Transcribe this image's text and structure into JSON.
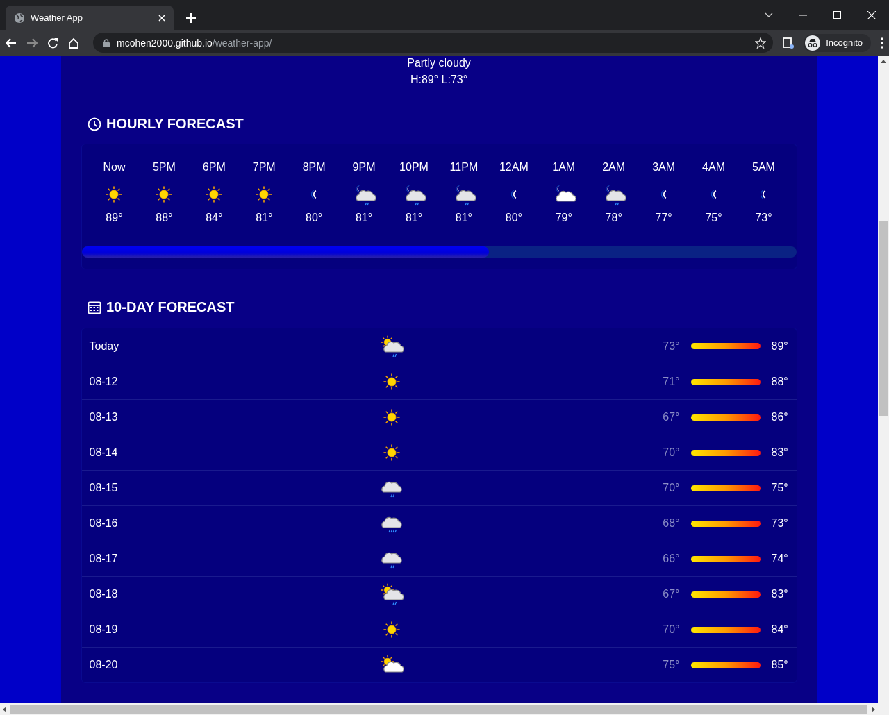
{
  "browser": {
    "tab_title": "Weather App",
    "url_host": "mcohen2000.github.io",
    "url_path": "/weather-app/",
    "profile": "Incognito"
  },
  "current": {
    "condition": "Partly cloudy",
    "high_low": "H:89° L:73°"
  },
  "hourly": {
    "title": "HOURLY FORECAST",
    "hours": [
      {
        "time": "Now",
        "kind": "sun",
        "temp": "89°"
      },
      {
        "time": "5PM",
        "kind": "sun",
        "temp": "88°"
      },
      {
        "time": "6PM",
        "kind": "sun",
        "temp": "84°"
      },
      {
        "time": "7PM",
        "kind": "sun",
        "temp": "81°"
      },
      {
        "time": "8PM",
        "kind": "moon",
        "temp": "80°"
      },
      {
        "time": "9PM",
        "kind": "moon-cloud-rain",
        "temp": "81°"
      },
      {
        "time": "10PM",
        "kind": "moon-cloud-rain",
        "temp": "81°"
      },
      {
        "time": "11PM",
        "kind": "moon-cloud-rain",
        "temp": "81°"
      },
      {
        "time": "12AM",
        "kind": "moon",
        "temp": "80°"
      },
      {
        "time": "1AM",
        "kind": "moon-cloud",
        "temp": "79°"
      },
      {
        "time": "2AM",
        "kind": "moon-cloud-rain",
        "temp": "78°"
      },
      {
        "time": "3AM",
        "kind": "moon",
        "temp": "77°"
      },
      {
        "time": "4AM",
        "kind": "moon",
        "temp": "75°"
      },
      {
        "time": "5AM",
        "kind": "moon",
        "temp": "73°"
      }
    ]
  },
  "daily": {
    "title": "10-DAY FORECAST",
    "days": [
      {
        "day": "Today",
        "kind": "sun-cloud-rain",
        "low": "73°",
        "high": "89°"
      },
      {
        "day": "08-12",
        "kind": "sun",
        "low": "71°",
        "high": "88°"
      },
      {
        "day": "08-13",
        "kind": "sun",
        "low": "67°",
        "high": "86°"
      },
      {
        "day": "08-14",
        "kind": "sun",
        "low": "70°",
        "high": "83°"
      },
      {
        "day": "08-15",
        "kind": "cloud-rain",
        "low": "70°",
        "high": "75°"
      },
      {
        "day": "08-16",
        "kind": "cloud-heavy-rain",
        "low": "68°",
        "high": "73°"
      },
      {
        "day": "08-17",
        "kind": "cloud-rain",
        "low": "66°",
        "high": "74°"
      },
      {
        "day": "08-18",
        "kind": "sun-cloud-rain",
        "low": "67°",
        "high": "83°"
      },
      {
        "day": "08-19",
        "kind": "sun",
        "low": "70°",
        "high": "84°"
      },
      {
        "day": "08-20",
        "kind": "sun-cloud",
        "low": "75°",
        "high": "85°"
      }
    ]
  }
}
